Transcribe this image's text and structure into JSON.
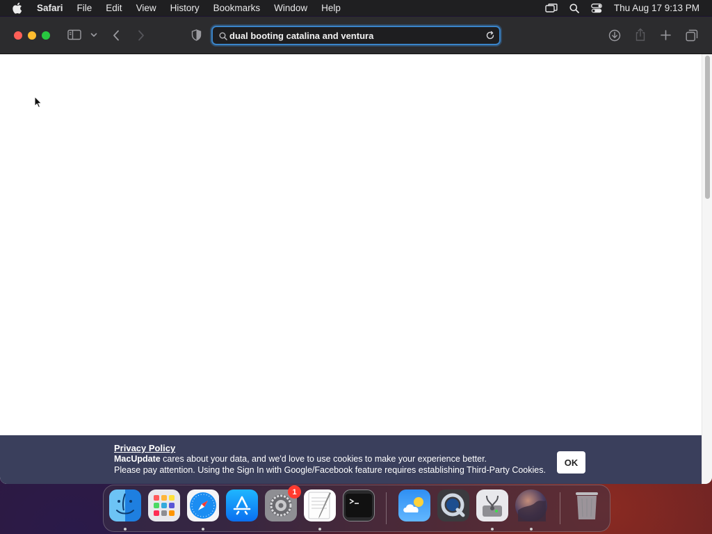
{
  "menubar": {
    "app_name": "Safari",
    "items": [
      "File",
      "Edit",
      "View",
      "History",
      "Bookmarks",
      "Window",
      "Help"
    ],
    "clock": "Thu Aug 17  9:13 PM"
  },
  "browser": {
    "address_bar_text": "dual booting catalina and ventura"
  },
  "privacy_banner": {
    "title": "Privacy Policy",
    "brand": "MacUpdate",
    "line1_rest": " cares about your data, and we'd love to use cookies to make your experience better.",
    "line2": "Please pay attention. Using the Sign In with Google/Facebook feature requires establishing Third-Party Cookies.",
    "ok_label": "OK"
  },
  "dock": {
    "apps": [
      "finder-icon",
      "launchpad-icon",
      "safari-icon",
      "app-store-icon",
      "system-settings-icon",
      "textedit-icon",
      "terminal-icon",
      "weather-icon",
      "quicktime-icon",
      "disk-utility-icon",
      "macos-installer-icon",
      "trash-icon"
    ],
    "system_settings_badge": "1"
  },
  "colors": {
    "accent": "#3a84c9",
    "banner_bg": "#3a3f5c",
    "close": "#ff5f57",
    "minimize": "#febc2e",
    "zoom": "#28c840"
  }
}
